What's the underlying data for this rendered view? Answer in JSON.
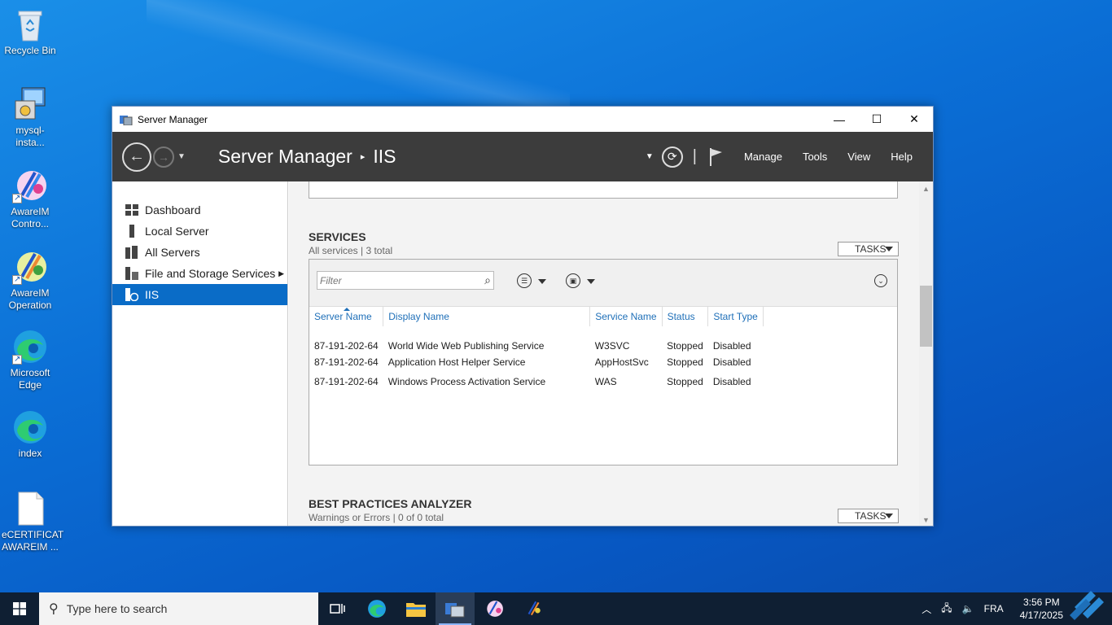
{
  "desktop": {
    "icons": [
      {
        "label": "Recycle Bin"
      },
      {
        "label": "mysql-insta..."
      },
      {
        "label": "AwareIM Contro..."
      },
      {
        "label": "AwareIM Operation"
      },
      {
        "label": "Microsoft Edge"
      },
      {
        "label": "index"
      },
      {
        "label": "eCERTIFICAT AWAREIM ..."
      }
    ]
  },
  "window": {
    "title": "Server Manager",
    "controls": {
      "minimize": "—",
      "maximize": "☐",
      "close": "✕"
    }
  },
  "header": {
    "breadcrumb_root": "Server Manager",
    "breadcrumb_sep": "▸",
    "breadcrumb_current": "IIS",
    "menu": {
      "manage": "Manage",
      "tools": "Tools",
      "view": "View",
      "help": "Help"
    }
  },
  "sidebar": {
    "items": [
      {
        "label": "Dashboard"
      },
      {
        "label": "Local Server"
      },
      {
        "label": "All Servers"
      },
      {
        "label": "File and Storage Services"
      },
      {
        "label": "IIS"
      }
    ]
  },
  "services": {
    "title": "SERVICES",
    "subtitle": "All services | 3 total",
    "tasks_label": "TASKS",
    "filter_placeholder": "Filter",
    "columns": [
      "Server Name",
      "Display Name",
      "Service Name",
      "Status",
      "Start Type"
    ],
    "rows": [
      [
        "87-191-202-64",
        "World Wide Web Publishing Service",
        "W3SVC",
        "Stopped",
        "Disabled"
      ],
      [
        "87-191-202-64",
        "Application Host Helper Service",
        "AppHostSvc",
        "Stopped",
        "Disabled"
      ],
      [
        "87-191-202-64",
        "Windows Process Activation Service",
        "WAS",
        "Stopped",
        "Disabled"
      ]
    ]
  },
  "bpa": {
    "title": "BEST PRACTICES ANALYZER",
    "subtitle": "Warnings or Errors | 0 of 0 total",
    "tasks_label": "TASKS"
  },
  "taskbar": {
    "search_placeholder": "Type here to search",
    "language": "FRA",
    "time": "3:56 PM",
    "date": "4/17/2025"
  },
  "colors": {
    "accent": "#0a6cc7",
    "header_bg": "#3c3c3c",
    "link": "#1e6fb8"
  }
}
